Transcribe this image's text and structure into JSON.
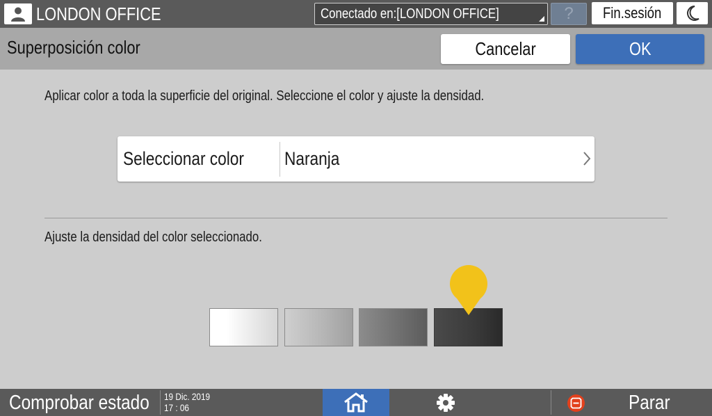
{
  "topbar": {
    "office_name": "LONDON OFFICE",
    "connected_to": "Conectado en:[LONDON OFFICE]",
    "help_label": "?",
    "logout_label": "Fin.sesión"
  },
  "titlebar": {
    "title": "Superposición color",
    "cancel_label": "Cancelar",
    "ok_label": "OK"
  },
  "main": {
    "instruction": "Aplicar color a toda la superficie del original. Seleccione el color y ajuste la densidad.",
    "color_select": {
      "label": "Seleccionar color",
      "value": "Naranja"
    },
    "density_label": "Ajuste la densidad del color seleccionado.",
    "density": {
      "levels": 4,
      "selected": 4
    }
  },
  "bottombar": {
    "status_label": "Comprobar estado",
    "date": "19 Dic. 2019",
    "time": "17 : 06",
    "stop_label": "Parar"
  },
  "colors": {
    "accent_blue": "#3d6fb8",
    "marker_yellow": "#f2c21a",
    "stop_orange": "#e2401c"
  }
}
